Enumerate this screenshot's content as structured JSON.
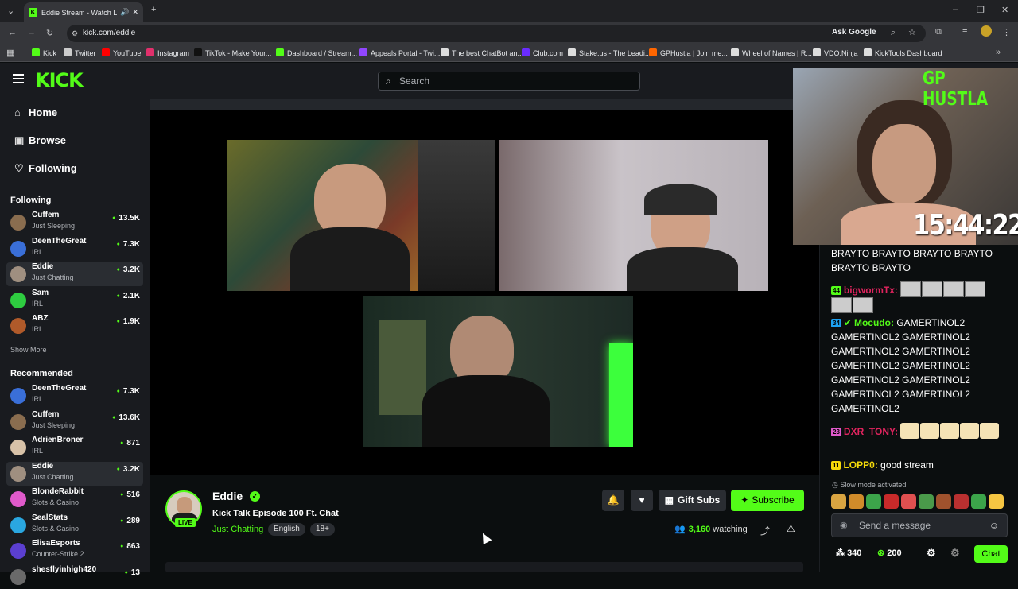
{
  "browser": {
    "tab_title": "Eddie Stream - Watch Live o",
    "url": "kick.com/eddie",
    "ask_google": "Ask Google",
    "bookmarks": [
      {
        "label": "Kick",
        "color": "#53fc18"
      },
      {
        "label": "Twitter",
        "color": "#cccccc"
      },
      {
        "label": "YouTube",
        "color": "#ff0000"
      },
      {
        "label": "Instagram",
        "color": "#e1306c"
      },
      {
        "label": "TikTok - Make Your...",
        "color": "#111111"
      },
      {
        "label": "Dashboard / Stream...",
        "color": "#53fc18"
      },
      {
        "label": "Appeals Portal - Twi...",
        "color": "#9146ff"
      },
      {
        "label": "The best ChatBot an...",
        "color": "#dddddd"
      },
      {
        "label": "Club.com",
        "color": "#6a2cff"
      },
      {
        "label": "Stake.us - The Leadi...",
        "color": "#dddddd"
      },
      {
        "label": "GPHustla | Join me...",
        "color": "#ff6600"
      },
      {
        "label": "Wheel of Names | R...",
        "color": "#dddddd"
      },
      {
        "label": "VDO.Ninja",
        "color": "#dddddd"
      },
      {
        "label": "KickTools Dashboard",
        "color": "#dddddd"
      }
    ]
  },
  "header": {
    "logo": "KICK",
    "search_placeholder": "Search"
  },
  "sidebar": {
    "nav": [
      {
        "label": "Home",
        "icon": "home-icon"
      },
      {
        "label": "Browse",
        "icon": "browse-icon"
      },
      {
        "label": "Following",
        "icon": "heart-icon"
      }
    ],
    "following_heading": "Following",
    "following": [
      {
        "name": "Cuffem",
        "category": "Just Sleeping",
        "viewers": "13.5K",
        "color": "#8a6d4f"
      },
      {
        "name": "DeenTheGreat",
        "category": "IRL",
        "viewers": "7.3K",
        "color": "#3a6fd8"
      },
      {
        "name": "Eddie",
        "category": "Just Chatting",
        "viewers": "3.2K",
        "color": "#9f8f80",
        "active": true
      },
      {
        "name": "Sam",
        "category": "IRL",
        "viewers": "2.1K",
        "color": "#2ecc40"
      },
      {
        "name": "ABZ",
        "category": "IRL",
        "viewers": "1.9K",
        "color": "#b05a2a"
      }
    ],
    "show_more": "Show More",
    "recommended_heading": "Recommended",
    "recommended": [
      {
        "name": "DeenTheGreat",
        "category": "IRL",
        "viewers": "7.3K",
        "color": "#3a6fd8"
      },
      {
        "name": "Cuffem",
        "category": "Just Sleeping",
        "viewers": "13.6K",
        "color": "#8a6d4f"
      },
      {
        "name": "AdrienBroner",
        "category": "IRL",
        "viewers": "871",
        "color": "#d8c2a8"
      },
      {
        "name": "Eddie",
        "category": "Just Chatting",
        "viewers": "3.2K",
        "color": "#9f8f80",
        "active": true
      },
      {
        "name": "BlondeRabbit",
        "category": "Slots & Casino",
        "viewers": "516",
        "color": "#e05acb"
      },
      {
        "name": "SealStats",
        "category": "Slots & Casino",
        "viewers": "289",
        "color": "#2aa7e0"
      },
      {
        "name": "ElisaEsports",
        "category": "Counter-Strike 2",
        "viewers": "863",
        "color": "#5b3fd0"
      },
      {
        "name": "shesflyinhigh420",
        "category": "",
        "viewers": "13",
        "color": "#6a6a6a"
      }
    ]
  },
  "stream": {
    "channel": "Eddie",
    "live": "LIVE",
    "title": "Kick Talk Episode 100 Ft. Chat",
    "category": "Just Chatting",
    "tags": [
      "English",
      "18+"
    ],
    "gift_subs": "Gift Subs",
    "subscribe": "Subscribe",
    "viewers": "3,160",
    "watching_label": "watching"
  },
  "overlay": {
    "brand": "GP HUSTLA",
    "clock": "15:44:22"
  },
  "chat": {
    "messages": [
      {
        "badge": "",
        "badge_color": "",
        "user": "",
        "user_color": "",
        "text": "BRAYTO BRAYTO BRAYTO BRAYTO BRAYTO BRAYTO",
        "emotes": 0
      },
      {
        "badge": "44",
        "badge_color": "#53fc18",
        "user": "bigwormTx:",
        "user_color": "#e0245e",
        "text": "",
        "emotes": 6
      },
      {
        "badge": "34",
        "badge_color": "#1da1f2",
        "user": "Mocudo:",
        "user_color": "#53fc18",
        "text": "GAMERTINOL2 GAMERTINOL2 GAMERTINOL2 GAMERTINOL2 GAMERTINOL2 GAMERTINOL2 GAMERTINOL2 GAMERTINOL2 GAMERTINOL2 GAMERTINOL2 GAMERTINOL2 GAMERTINOL2",
        "emotes": 0
      },
      {
        "badge": "23",
        "badge_color": "#e05acb",
        "user": "DXR_TONY:",
        "user_color": "#e0245e",
        "text": "",
        "emotes": 5
      },
      {
        "badge": "11",
        "badge_color": "#f5d90a",
        "user": "LOPP0:",
        "user_color": "#f5d90a",
        "text": "good stream",
        "emotes": 0
      }
    ],
    "slow_mode": "Slow mode activated",
    "input_placeholder": "Send a message",
    "points_1": "340",
    "points_2": "200",
    "chat_button": "Chat"
  }
}
